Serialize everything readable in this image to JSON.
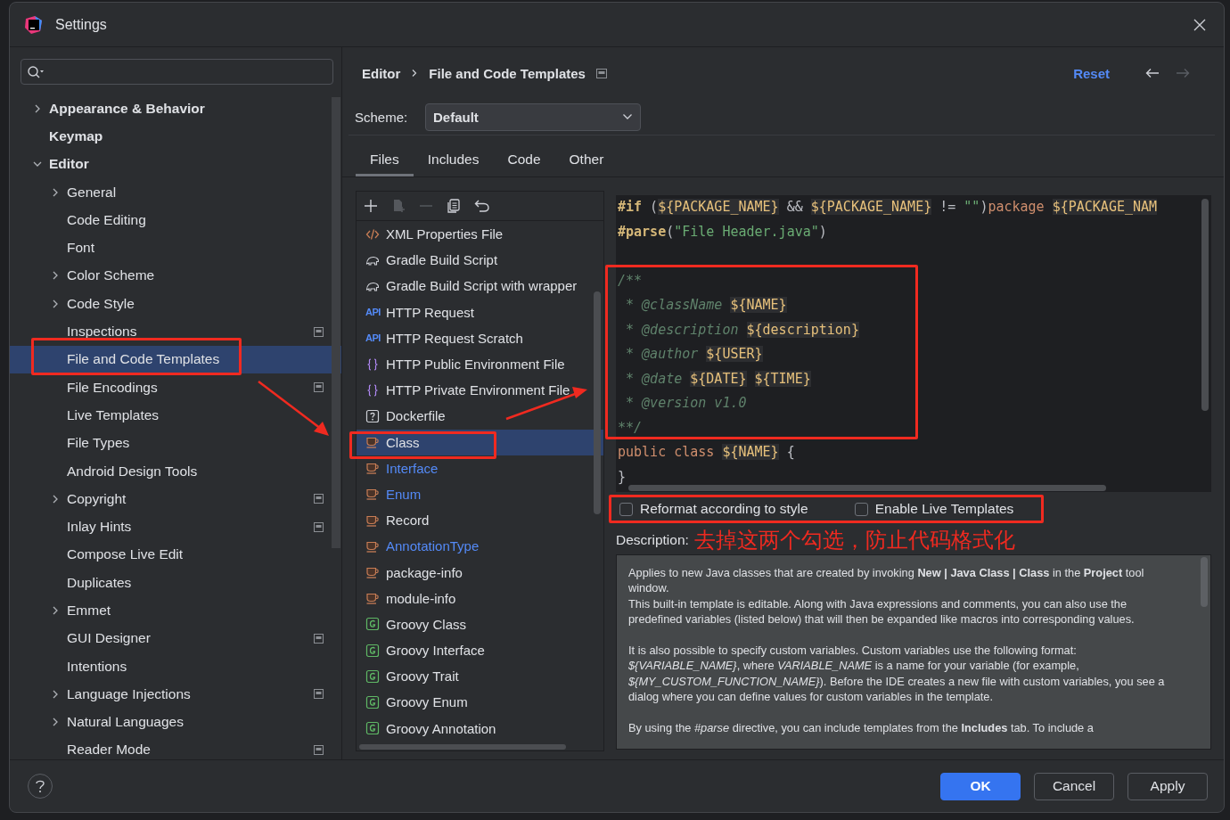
{
  "window": {
    "title": "Settings"
  },
  "sidebar": {
    "items": [
      {
        "label": "Appearance & Behavior",
        "kind": "group",
        "expanded": false,
        "scoped": false,
        "selected": false
      },
      {
        "label": "Keymap",
        "kind": "leaf",
        "scoped": false,
        "selected": false
      },
      {
        "label": "Editor",
        "kind": "group",
        "expanded": true,
        "scoped": false,
        "selected": false,
        "children": [
          {
            "label": "General",
            "kind": "group",
            "expanded": false,
            "scoped": false,
            "selected": false
          },
          {
            "label": "Code Editing",
            "kind": "leaf",
            "scoped": false,
            "selected": false
          },
          {
            "label": "Font",
            "kind": "leaf",
            "scoped": false,
            "selected": false
          },
          {
            "label": "Color Scheme",
            "kind": "group",
            "expanded": false,
            "scoped": false,
            "selected": false
          },
          {
            "label": "Code Style",
            "kind": "group",
            "expanded": false,
            "scoped": false,
            "selected": false
          },
          {
            "label": "Inspections",
            "kind": "leaf",
            "scoped": true,
            "selected": false
          },
          {
            "label": "File and Code Templates",
            "kind": "leaf",
            "scoped": false,
            "selected": true
          },
          {
            "label": "File Encodings",
            "kind": "leaf",
            "scoped": true,
            "selected": false
          },
          {
            "label": "Live Templates",
            "kind": "leaf",
            "scoped": false,
            "selected": false
          },
          {
            "label": "File Types",
            "kind": "leaf",
            "scoped": false,
            "selected": false
          },
          {
            "label": "Android Design Tools",
            "kind": "leaf",
            "scoped": false,
            "selected": false
          },
          {
            "label": "Copyright",
            "kind": "group",
            "expanded": false,
            "scoped": true,
            "selected": false
          },
          {
            "label": "Inlay Hints",
            "kind": "leaf",
            "scoped": true,
            "selected": false
          },
          {
            "label": "Compose Live Edit",
            "kind": "leaf",
            "scoped": false,
            "selected": false
          },
          {
            "label": "Duplicates",
            "kind": "leaf",
            "scoped": false,
            "selected": false
          },
          {
            "label": "Emmet",
            "kind": "group",
            "expanded": false,
            "scoped": false,
            "selected": false
          },
          {
            "label": "GUI Designer",
            "kind": "leaf",
            "scoped": true,
            "selected": false
          },
          {
            "label": "Intentions",
            "kind": "leaf",
            "scoped": false,
            "selected": false
          },
          {
            "label": "Language Injections",
            "kind": "group",
            "expanded": false,
            "scoped": true,
            "selected": false
          },
          {
            "label": "Natural Languages",
            "kind": "group",
            "expanded": false,
            "scoped": false,
            "selected": false
          },
          {
            "label": "Reader Mode",
            "kind": "leaf",
            "scoped": true,
            "selected": false
          }
        ]
      }
    ]
  },
  "breadcrumb": [
    "Editor",
    "File and Code Templates"
  ],
  "reset": "Reset",
  "scheme": {
    "label": "Scheme:",
    "value": "Default"
  },
  "tabs": [
    {
      "label": "Files",
      "selected": true
    },
    {
      "label": "Includes",
      "selected": false
    },
    {
      "label": "Code",
      "selected": false
    },
    {
      "label": "Other",
      "selected": false
    }
  ],
  "templates": [
    {
      "name": "XML Properties File",
      "kind": "xml",
      "modified": false,
      "selected": false
    },
    {
      "name": "Gradle Build Script",
      "kind": "gradle",
      "modified": false,
      "selected": false
    },
    {
      "name": "Gradle Build Script with wrapper",
      "kind": "gradle",
      "modified": false,
      "selected": false
    },
    {
      "name": "HTTP Request",
      "kind": "api",
      "badge": "API",
      "modified": false,
      "selected": false
    },
    {
      "name": "HTTP Request Scratch",
      "kind": "api",
      "badge": "API",
      "modified": false,
      "selected": false
    },
    {
      "name": "HTTP Public Environment File",
      "kind": "env",
      "modified": false,
      "selected": false
    },
    {
      "name": "HTTP Private Environment File",
      "kind": "env",
      "modified": false,
      "selected": false
    },
    {
      "name": "Dockerfile",
      "kind": "docker",
      "modified": false,
      "selected": false
    },
    {
      "name": "Class",
      "kind": "java",
      "modified": false,
      "selected": true
    },
    {
      "name": "Interface",
      "kind": "java",
      "modified": true,
      "selected": false
    },
    {
      "name": "Enum",
      "kind": "java",
      "modified": true,
      "selected": false
    },
    {
      "name": "Record",
      "kind": "java",
      "modified": false,
      "selected": false
    },
    {
      "name": "AnnotationType",
      "kind": "java",
      "modified": true,
      "selected": false
    },
    {
      "name": "package-info",
      "kind": "java",
      "modified": false,
      "selected": false
    },
    {
      "name": "module-info",
      "kind": "java",
      "modified": false,
      "selected": false
    },
    {
      "name": "Groovy Class",
      "kind": "groovy",
      "modified": false,
      "selected": false
    },
    {
      "name": "Groovy Interface",
      "kind": "groovy",
      "modified": false,
      "selected": false
    },
    {
      "name": "Groovy Trait",
      "kind": "groovy",
      "modified": false,
      "selected": false
    },
    {
      "name": "Groovy Enum",
      "kind": "groovy",
      "modified": false,
      "selected": false
    },
    {
      "name": "Groovy Annotation",
      "kind": "groovy",
      "modified": false,
      "selected": false
    }
  ],
  "editor": {
    "lines": [
      {
        "kind": "code",
        "tokens": [
          {
            "kind": "directive",
            "text": "#if"
          },
          {
            "kind": "plain",
            "text": " ("
          },
          {
            "kind": "var",
            "text": "${PACKAGE_NAME}"
          },
          {
            "kind": "plain",
            "text": " && "
          },
          {
            "kind": "var",
            "text": "${PACKAGE_NAME}"
          },
          {
            "kind": "plain",
            "text": " != "
          },
          {
            "kind": "string",
            "text": "\"\""
          },
          {
            "kind": "plain",
            "text": ")"
          },
          {
            "kind": "keyword",
            "text": "package "
          },
          {
            "kind": "var",
            "text": "${PACKAGE_NAM"
          }
        ]
      },
      {
        "kind": "code",
        "tokens": [
          {
            "kind": "directive",
            "text": "#parse"
          },
          {
            "kind": "plain",
            "text": "("
          },
          {
            "kind": "string",
            "text": "\"File Header.java\""
          },
          {
            "kind": "plain",
            "text": ")"
          }
        ]
      },
      {
        "kind": "blank"
      },
      {
        "kind": "code",
        "tokens": [
          {
            "kind": "comment",
            "text": "/**"
          }
        ]
      },
      {
        "kind": "code",
        "tokens": [
          {
            "kind": "comment",
            "text": " * @className "
          },
          {
            "kind": "var",
            "text": "${NAME}"
          }
        ]
      },
      {
        "kind": "code",
        "tokens": [
          {
            "kind": "comment",
            "text": " * @description "
          },
          {
            "kind": "var",
            "text": "${description}"
          }
        ]
      },
      {
        "kind": "code",
        "tokens": [
          {
            "kind": "comment",
            "text": " * @author "
          },
          {
            "kind": "var",
            "text": "${USER}"
          }
        ]
      },
      {
        "kind": "code",
        "tokens": [
          {
            "kind": "comment",
            "text": " * @date "
          },
          {
            "kind": "var",
            "text": "${DATE}"
          },
          {
            "kind": "var",
            "text": "${TIME}",
            "spaced": true
          }
        ]
      },
      {
        "kind": "code",
        "tokens": [
          {
            "kind": "comment",
            "text": " * @version v1.0"
          }
        ]
      },
      {
        "kind": "code",
        "tokens": [
          {
            "kind": "comment",
            "text": "**/"
          }
        ]
      },
      {
        "kind": "code",
        "tokens": [
          {
            "kind": "keyword",
            "text": "public class "
          },
          {
            "kind": "var",
            "text": "${NAME}"
          },
          {
            "kind": "plain",
            "text": " {"
          }
        ]
      },
      {
        "kind": "code",
        "tokens": [
          {
            "kind": "plain",
            "text": "}"
          }
        ]
      }
    ]
  },
  "options": [
    {
      "label": "Reformat according to style",
      "checked": false
    },
    {
      "label": "Enable Live Templates",
      "checked": false
    }
  ],
  "description": {
    "label": "Description:",
    "paragraphs": [
      {
        "lines": [
          "Applies to new Java classes that are created by invoking **New | Java Class | Class** in the **Project** tool window.",
          "This built-in template is editable. Along with Java expressions and comments, you can also use the predefined variables (listed below) that will then be expanded like macros into corresponding values."
        ]
      },
      {
        "lines": [
          "It is also possible to specify custom variables. Custom variables use the following format: *${VARIABLE_NAME}*, where *VARIABLE_NAME* is a name for your variable (for example, *${MY_CUSTOM_FUNCTION_NAME}*). Before the IDE creates a new file with custom variables, you see a dialog where you can define values for custom variables in the template."
        ]
      },
      {
        "lines": [
          "By using the *#parse* directive, you can include templates from the **Includes** tab. To include a"
        ]
      }
    ]
  },
  "annotation": {
    "note": "去掉这两个勾选，防止代码格式化"
  },
  "buttons": [
    {
      "label": "OK",
      "kind": "primary"
    },
    {
      "label": "Cancel",
      "kind": "secondary"
    },
    {
      "label": "Apply",
      "kind": "secondary"
    }
  ]
}
